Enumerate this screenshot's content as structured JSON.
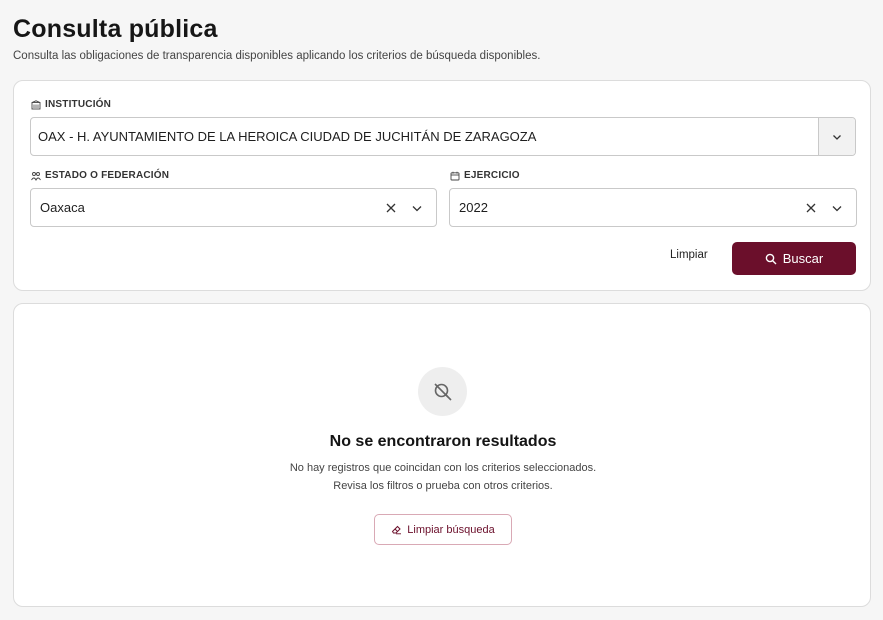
{
  "header": {
    "title": "Consulta pública",
    "subtitle": "Consulta las obligaciones de transparencia disponibles aplicando los criterios de búsqueda disponibles."
  },
  "filters": {
    "institucion": {
      "label": "INSTITUCIÓN",
      "icon": "building-icon",
      "value": "OAX - H. AYUNTAMIENTO DE LA HEROICA CIUDAD DE JUCHITÁN DE ZARAGOZA"
    },
    "estado": {
      "label": "ESTADO O FEDERACIÓN",
      "icon": "people-icon",
      "value": "Oaxaca"
    },
    "ejercicio": {
      "label": "EJERCICIO",
      "icon": "calendar-icon",
      "value": "2022"
    },
    "limpiar_label": "Limpiar",
    "buscar_label": "Buscar"
  },
  "results": {
    "empty_icon": "search-off-icon",
    "title": "No se encontraron resultados",
    "line1": "No hay registros que coincidan con los criterios seleccionados.",
    "line2": "Revisa los filtros o prueba con otros criterios.",
    "clear_label": "Limpiar búsqueda"
  },
  "colors": {
    "brand": "#6b0f2b",
    "background": "#f6f6f6",
    "card": "#ffffff"
  }
}
